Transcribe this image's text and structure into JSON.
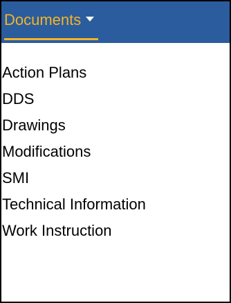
{
  "menu_button": {
    "label": "Documents",
    "icon": "caret-down-icon"
  },
  "menu": {
    "items": [
      {
        "label": "Action Plans"
      },
      {
        "label": "DDS"
      },
      {
        "label": "Drawings"
      },
      {
        "label": "Modifications"
      },
      {
        "label": "SMI"
      },
      {
        "label": "Technical Information"
      },
      {
        "label": "Work Instruction"
      }
    ]
  },
  "colors": {
    "header_background": "#2b5d9e",
    "accent": "#f5b324",
    "caret": "#ffffff",
    "menu_background": "#ffffff",
    "menu_text": "#000000",
    "frame_border": "#000000"
  }
}
